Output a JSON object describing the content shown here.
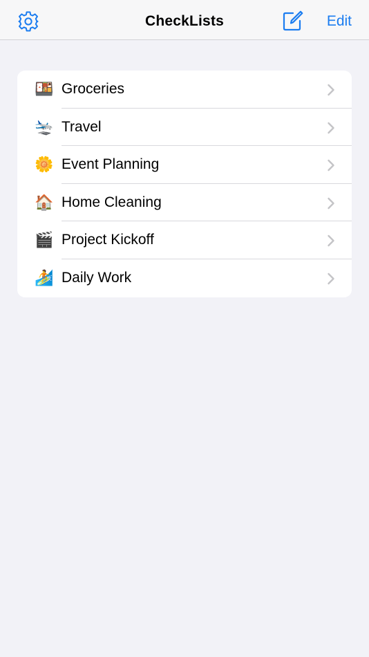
{
  "colors": {
    "accent": "#1a7cf0",
    "background": "#f2f2f7",
    "chevron": "#c4c4c7"
  },
  "navbar": {
    "title": "CheckLists",
    "edit_label": "Edit",
    "left_icon": "gear-icon",
    "right_icon": "compose-icon"
  },
  "checklists": [
    {
      "label": "Groceries",
      "emoji": "🍱",
      "icon": "bento-box-icon"
    },
    {
      "label": "Travel",
      "emoji": "🛬",
      "icon": "airplane-arriving-icon"
    },
    {
      "label": "Event Planning",
      "emoji": "🌼",
      "icon": "blossom-icon"
    },
    {
      "label": "Home Cleaning",
      "emoji": "🏠",
      "icon": "house-icon"
    },
    {
      "label": "Project Kickoff",
      "emoji": "🎬",
      "icon": "clapper-board-icon"
    },
    {
      "label": "Daily Work",
      "emoji": "🏄",
      "icon": "surfer-icon"
    }
  ]
}
